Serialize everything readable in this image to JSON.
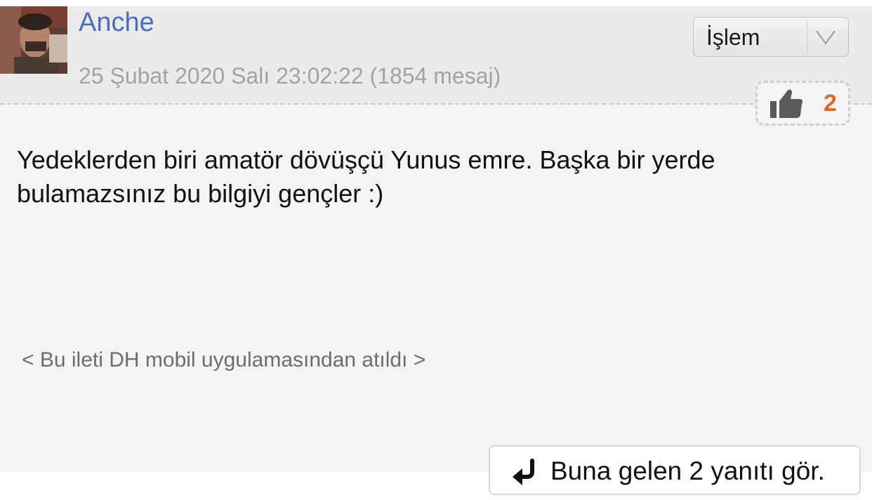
{
  "post": {
    "author": "Anche",
    "meta": "25 Şubat 2020 Salı 23:02:22 (1854 mesaj)",
    "body_line1": "Yedeklerden biri amatör dövüşçü Yunus emre. Başka bir yerde",
    "body_line2": "bulamazsınız bu bilgiyi gençler :)",
    "mobile_note": "< Bu ileti DH mobil uygulamasından atıldı >"
  },
  "action_menu": {
    "selected": "İşlem",
    "icon": "chevron-down-icon"
  },
  "like": {
    "icon": "thumbs-up-icon",
    "count": "2"
  },
  "replies": {
    "icon": "reply-arrow-icon",
    "label": "Buna gelen 2 yanıtı gör."
  },
  "colors": {
    "username": "#4a6fc0",
    "like_count": "#e0692a",
    "header_bg": "#ebebeb",
    "body_bg": "#f4f4f4"
  }
}
